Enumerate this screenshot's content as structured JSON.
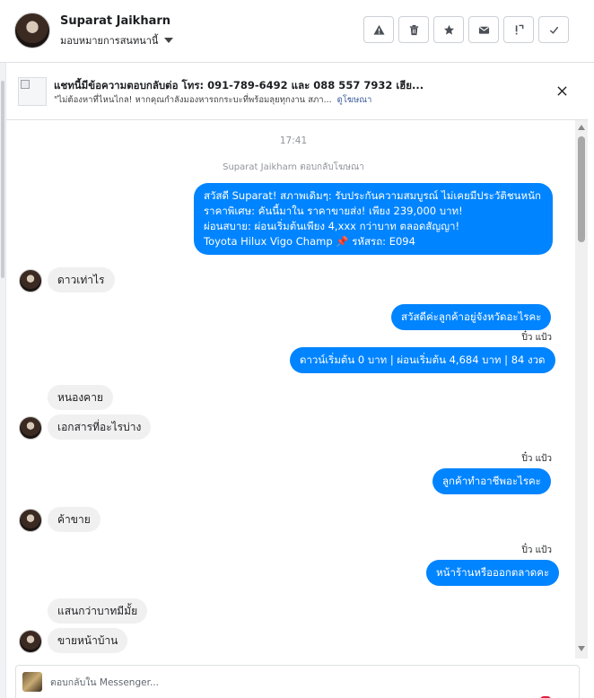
{
  "header": {
    "contact_name": "Suparat Jaikharn",
    "assign_label": "มอบหมายการสนทนานี้",
    "actions": [
      {
        "icon": "warning-icon"
      },
      {
        "icon": "trash-icon"
      },
      {
        "icon": "star-icon"
      },
      {
        "icon": "envelope-icon"
      },
      {
        "icon": "follow-up-icon"
      },
      {
        "icon": "checkmark-icon"
      }
    ]
  },
  "banner": {
    "title": "แชทนี้มีข้อความตอบกลับต่อ โทร: 091-789-6492 และ 088 557 7932 เฮีย...",
    "subtitle": "\"ไม่ต้องหาที่ไหนไกล! หากคุณกำลังมองหารถกระบะที่พร้อมลุยทุกงาน สภา...",
    "link": "ดูโฆษณา"
  },
  "conversation": {
    "timestamp": "17:41",
    "replied_label": "Suparat Jaikharn ตอบกลับโฆษณา",
    "ad_message_lines": [
      "สวัสดี Suparat! สภาพเดิมๆ: รับประกันความสมบูรณ์ ไม่เคยมีประวัติชนหนัก",
      "ราคาพิเศษ: คันนี้มาใน ราคาขายส่ง! เพียง 239,000 บาท!",
      "ผ่อนสบาย: ผ่อนเริ่มต้นเพียง 4,xxx กว่าบาท ตลอดสัญญา!",
      "Toyota Hilux Vigo Champ 📌 รหัสรถ: E094"
    ],
    "messages": [
      {
        "from": "customer",
        "text": "ดาวเท่าไร"
      },
      {
        "from": "page",
        "text": "สวัสดีค่ะลูกค้าอยู่จังหวัดอะไรคะ"
      },
      {
        "from": "page",
        "text": "ดาวน์เริ่มต้น 0 บาท | ผ่อนเริ่มต้น 4,684 บาท | 84 งวด"
      },
      {
        "from": "customer",
        "text": "หนองคาย"
      },
      {
        "from": "customer",
        "text": "เอกสารที่อะไรบ่าง"
      },
      {
        "from": "page",
        "text": "ลูกค้าทำอาชีพอะไรคะ"
      },
      {
        "from": "customer",
        "text": "ค้าขาย"
      },
      {
        "from": "page",
        "text": "หน้าร้านหรือออกตลาดคะ"
      },
      {
        "from": "customer",
        "text": "แสนกว่าบาทมีมั้ย"
      },
      {
        "from": "customer",
        "text": "ขายหน้าบ้าน"
      }
    ],
    "sender_labels": [
      "ปิ๋ว แป้ว",
      "ปิ๋ว แป้ว",
      "ปิ๋ว แป้ว"
    ]
  },
  "composer": {
    "placeholder": "ตอบกลับใน Messenger..."
  },
  "colors": {
    "outgoing_bubble": "#0084ff",
    "incoming_bubble": "#f1f0f0",
    "link": "#385898"
  }
}
